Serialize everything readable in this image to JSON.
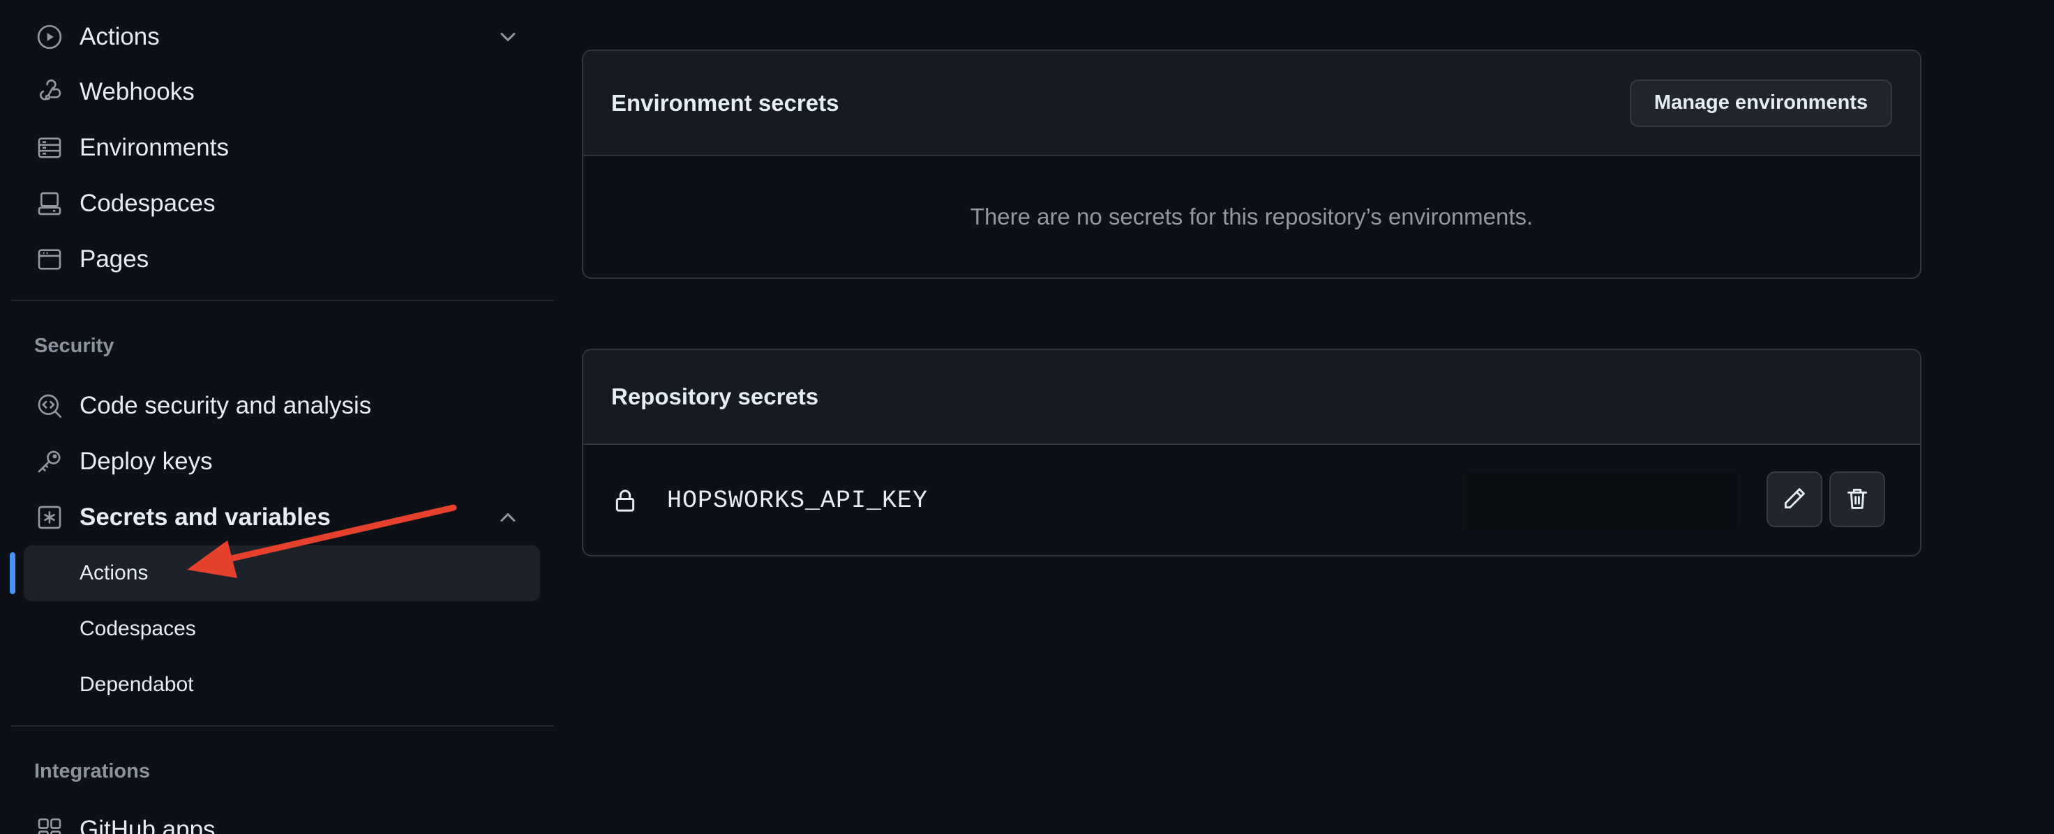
{
  "sidebar": {
    "top_items": [
      {
        "label": "Actions",
        "icon": "play-circle-icon"
      },
      {
        "label": "Webhooks",
        "icon": "webhook-icon"
      },
      {
        "label": "Environments",
        "icon": "server-icon"
      },
      {
        "label": "Codespaces",
        "icon": "codespaces-icon"
      },
      {
        "label": "Pages",
        "icon": "browser-icon"
      }
    ],
    "security_heading": "Security",
    "security_items": [
      {
        "label": "Code security and analysis",
        "icon": "codescan-icon"
      },
      {
        "label": "Deploy keys",
        "icon": "key-icon"
      },
      {
        "label": "Secrets and variables",
        "icon": "key-asterisk-icon"
      }
    ],
    "secrets_sub_items": [
      {
        "label": "Actions",
        "active": true
      },
      {
        "label": "Codespaces",
        "active": false
      },
      {
        "label": "Dependabot",
        "active": false
      }
    ],
    "integrations_heading": "Integrations",
    "integrations_items": [
      {
        "label": "GitHub apps",
        "icon": "apps-icon"
      }
    ]
  },
  "environment_secrets": {
    "title": "Environment secrets",
    "manage_button": "Manage environments",
    "empty_message": "There are no secrets for this repository’s environments."
  },
  "repository_secrets": {
    "title": "Repository secrets",
    "secrets": [
      {
        "name": "HOPSWORKS_API_KEY"
      }
    ]
  },
  "colors": {
    "background": "#0d1117",
    "panel_header": "#161b22",
    "border": "#30363d",
    "accent": "#4493f8",
    "annotation_arrow": "#e5412d"
  }
}
